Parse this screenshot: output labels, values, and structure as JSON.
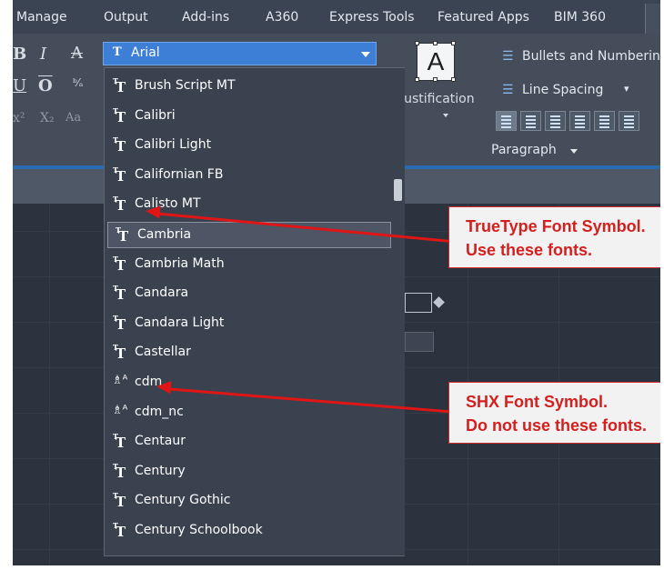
{
  "ribbon_tabs": [
    "Manage",
    "Output",
    "Add-ins",
    "A360",
    "Express Tools",
    "Featured Apps",
    "BIM 360"
  ],
  "font_selector": {
    "value": "Arial"
  },
  "justification": {
    "label": "Justification"
  },
  "paragraph": {
    "bullets_label": "Bullets and Numbering",
    "spacing_label": "Line Spacing",
    "panel_title": "Paragraph"
  },
  "font_list": [
    {
      "name": "Brush Script MT",
      "type": "truetype"
    },
    {
      "name": "Calibri",
      "type": "truetype"
    },
    {
      "name": "Calibri Light",
      "type": "truetype"
    },
    {
      "name": "Californian FB",
      "type": "truetype"
    },
    {
      "name": "Calisto MT",
      "type": "truetype"
    },
    {
      "name": "Cambria",
      "type": "truetype",
      "selected": true
    },
    {
      "name": "Cambria Math",
      "type": "truetype"
    },
    {
      "name": "Candara",
      "type": "truetype"
    },
    {
      "name": "Candara Light",
      "type": "truetype"
    },
    {
      "name": "Castellar",
      "type": "truetype"
    },
    {
      "name": "cdm",
      "type": "shx"
    },
    {
      "name": "cdm_nc",
      "type": "shx"
    },
    {
      "name": "Centaur",
      "type": "truetype"
    },
    {
      "name": "Century",
      "type": "truetype"
    },
    {
      "name": "Century Gothic",
      "type": "truetype"
    },
    {
      "name": "Century Schoolbook",
      "type": "truetype"
    }
  ],
  "callouts": {
    "truetype": {
      "line1": "TrueType Font Symbol.",
      "line2": "Use these fonts."
    },
    "shx": {
      "line1": "SHX Font Symbol.",
      "line2": "Do not use these fonts."
    }
  },
  "colors": {
    "ribbon_bg": "#454d5a",
    "tabbar_bg": "#3b4453",
    "combo_blue": "#3d7fd6",
    "dropdown_bg": "#3a4250",
    "callout_red": "#d41f1f",
    "arrow_red": "#e01515"
  },
  "icons": [
    "bold-icon",
    "italic-icon",
    "strikethrough-icon",
    "underline-icon",
    "overline-icon",
    "stack-icon",
    "superscript-icon",
    "subscript-icon",
    "case-icon",
    "truetype-font-icon",
    "shx-font-icon",
    "bullets-icon",
    "line-spacing-icon",
    "align-icons"
  ]
}
